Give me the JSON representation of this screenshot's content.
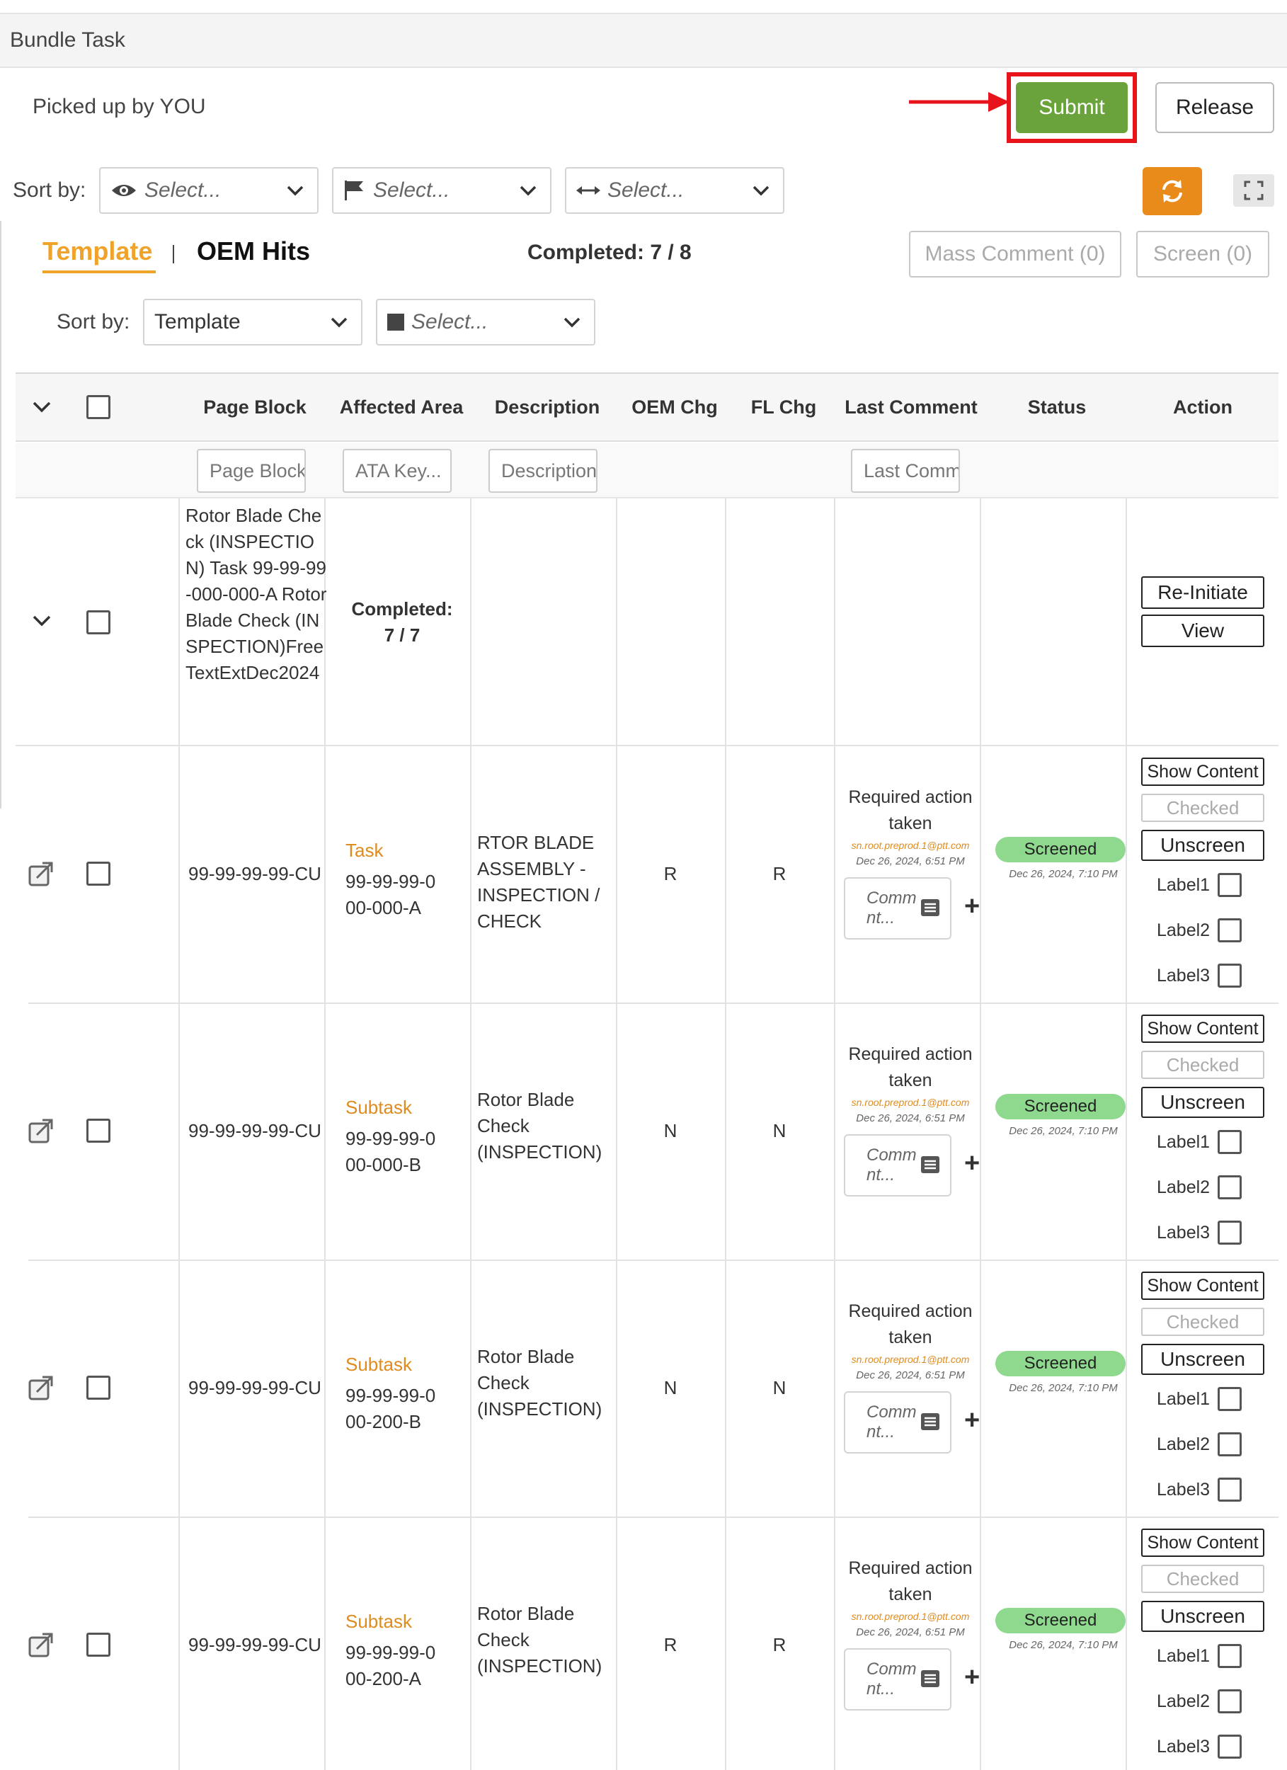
{
  "header": {
    "title": "Bundle Task"
  },
  "pickup": {
    "text": "Picked up by YOU",
    "submit_label": "Submit",
    "release_label": "Release"
  },
  "sort": {
    "label": "Sort by:",
    "select1": "Select...",
    "select2": "Select...",
    "select3": "Select..."
  },
  "tabs": {
    "template": "Template",
    "oem_hits": "OEM Hits",
    "completed": "Completed: 7 / 8"
  },
  "actions": {
    "mass_comment": "Mass Comment (0)",
    "screen": "Screen (0)"
  },
  "sort2": {
    "label": "Sort by:",
    "template": "Template",
    "select": "Select..."
  },
  "table": {
    "headers": [
      "Page Block",
      "Affected Area",
      "Description",
      "OEM Chg",
      "FL Chg",
      "Last Comment",
      "Status",
      "Action"
    ],
    "filters": {
      "page_block": "Page Block",
      "ata_key": "ATA Key...",
      "description": "Description",
      "last_comment": "Last Comm"
    },
    "group": {
      "description": "Rotor Blade Check (INSPECTION) Task 99-99-99-000-000-A Rotor Blade Check (INSPECTION)FreeTextExtDec2024",
      "completed_line1": "Completed:",
      "completed_line2": "7 / 7",
      "reinitiate": "Re-Initiate",
      "view": "View"
    },
    "rows": [
      {
        "page_block": "99-99-99-99-CU",
        "type": "Task",
        "ata": "99-99-99-000-000-A",
        "description": "RTOR BLADE ASSEMBLY - INSPECTION / CHECK",
        "oem": "R",
        "fl": "R",
        "comment": "Required action taken",
        "user": "sn.root.preprod.1@ptt.com",
        "comment_date": "Dec 26, 2024, 6:51 PM",
        "status": "Screened",
        "status_date": "Dec 26, 2024, 7:10 PM"
      },
      {
        "page_block": "99-99-99-99-CU",
        "type": "Subtask",
        "ata": "99-99-99-000-000-B",
        "description": "Rotor Blade Check (INSPECTION)",
        "oem": "N",
        "fl": "N",
        "comment": "Required action taken",
        "user": "sn.root.preprod.1@ptt.com",
        "comment_date": "Dec 26, 2024, 6:51 PM",
        "status": "Screened",
        "status_date": "Dec 26, 2024, 7:10 PM"
      },
      {
        "page_block": "99-99-99-99-CU",
        "type": "Subtask",
        "ata": "99-99-99-000-200-B",
        "description": "Rotor Blade Check (INSPECTION)",
        "oem": "N",
        "fl": "N",
        "comment": "Required action taken",
        "user": "sn.root.preprod.1@ptt.com",
        "comment_date": "Dec 26, 2024, 6:51 PM",
        "status": "Screened",
        "status_date": "Dec 26, 2024, 7:10 PM"
      },
      {
        "page_block": "99-99-99-99-CU",
        "type": "Subtask",
        "ata": "99-99-99-000-200-A",
        "description": "Rotor Blade Check (INSPECTION)",
        "oem": "R",
        "fl": "R",
        "comment": "Required action taken",
        "user": "sn.root.preprod.1@ptt.com",
        "comment_date": "Dec 26, 2024, 6:51 PM",
        "status": "Screened",
        "status_date": "Dec 26, 2024, 7:10 PM"
      }
    ],
    "row_actions": {
      "show_content": "Show Content",
      "checked": "Checked",
      "unscreen": "Unscreen",
      "labels": [
        "Label1",
        "Label2",
        "Label3"
      ],
      "comment_placeholder": "Comm nt..."
    }
  },
  "colors": {
    "accent_orange": "#f0a32b",
    "submit_green": "#6aa33b",
    "highlight_red": "#e8141c",
    "status_green": "#8fd98f"
  },
  "icons": [
    "eye-icon",
    "flag-icon",
    "arrows-horizontal-icon",
    "chevron-down-icon",
    "refresh-icon",
    "expand-icon",
    "external-link-icon",
    "comment-list-icon",
    "plus-icon"
  ]
}
